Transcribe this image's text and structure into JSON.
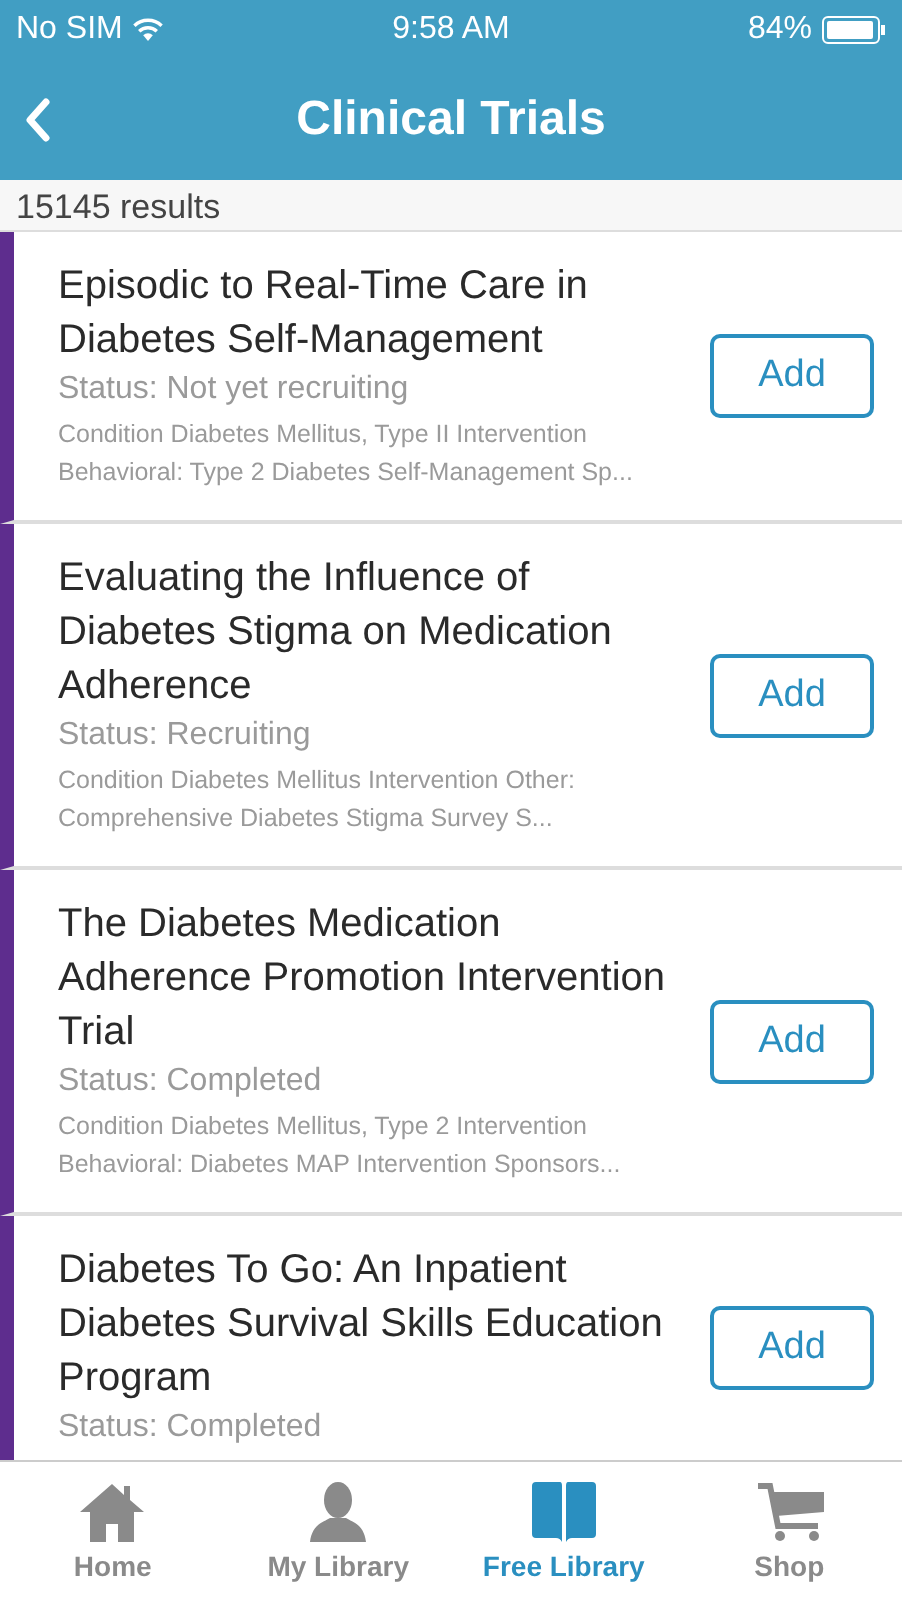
{
  "status_bar": {
    "carrier": "No SIM",
    "time": "9:58 AM",
    "battery": "84%"
  },
  "nav": {
    "title": "Clinical Trials"
  },
  "results": "15145 results",
  "trials": [
    {
      "title": "Episodic to Real-Time Care in Diabetes Self-Management",
      "status": "Status: Not yet recruiting",
      "details": "Condition Diabetes Mellitus, Type II Intervention Behavioral: Type 2 Diabetes Self-Management Sp...",
      "button": "Add"
    },
    {
      "title": "Evaluating the Influence of Diabetes Stigma on Medication Adherence",
      "status": "Status: Recruiting",
      "details": "Condition Diabetes Mellitus Intervention Other: Comprehensive Diabetes Stigma Survey S...",
      "button": "Add"
    },
    {
      "title": "The Diabetes Medication Adherence Promotion Intervention Trial",
      "status": "Status: Completed",
      "details": "Condition Diabetes Mellitus, Type 2 Intervention Behavioral: Diabetes MAP Intervention Sponsors...",
      "button": "Add"
    },
    {
      "title": "Diabetes To Go: An Inpatient Diabetes Survival Skills Education Program",
      "status": "Status: Completed",
      "button": "Add"
    }
  ],
  "tabs": [
    {
      "kind": "home",
      "label": "Home",
      "selected": false
    },
    {
      "kind": "person",
      "label": "My Library",
      "selected": false
    },
    {
      "kind": "book",
      "label": "Free Library",
      "selected": true
    },
    {
      "kind": "cart",
      "label": "Shop",
      "selected": false
    }
  ]
}
